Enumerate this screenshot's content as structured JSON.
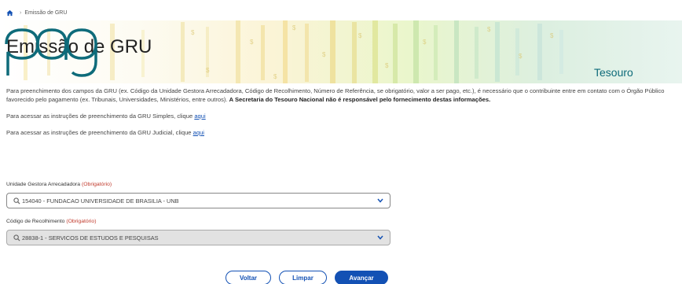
{
  "breadcrumb": {
    "current": "Emissão de GRU"
  },
  "banner": {
    "title": "Emissão de GRU",
    "logo_text": "pag",
    "logo_label": "Tesouro"
  },
  "info": {
    "paragraph1": "Para preenchimento dos campos da GRU (ex. Código da Unidade Gestora Arrecadadora, Código de Recolhimento, Número de Referência, se obrigatório, valor a ser pago, etc.), é necessário que o contribuinte entre em contato com o Órgão Público favorecido pelo pagamento (ex. Tribunais, Universidades, Ministérios, entre outros).",
    "paragraph1_bold": "A Secretaria do Tesouro Nacional não é responsável pelo fornecimento destas informações.",
    "simples_text": "Para acessar as instruções de preenchimento da GRU Simples, clique ",
    "judicial_text": "Para acessar as instruções de preenchimento da GRU Judicial, clique ",
    "link_label": "aqui"
  },
  "form": {
    "ug_label": "Unidade Gestora Arrecadadora",
    "required_label": "(Obrigatório)",
    "ug_value": "154040 - FUNDACAO UNIVERSIDADE DE BRASILIA - UNB",
    "codigo_label": "Código de Recolhimento",
    "codigo_value": "28838-1 - SERVICOS DE ESTUDOS E PESQUISAS"
  },
  "buttons": {
    "voltar": "Voltar",
    "limpar": "Limpar",
    "avancar": "Avançar"
  },
  "colors": {
    "primary": "#1351b4",
    "required": "#c0392b",
    "logo": "#0e6b7a"
  }
}
